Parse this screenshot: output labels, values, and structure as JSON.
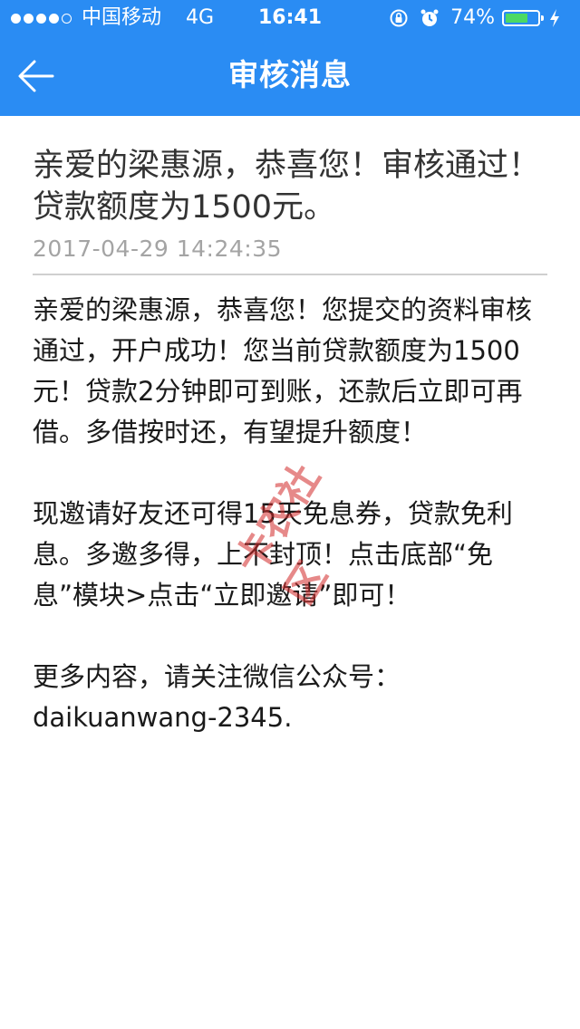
{
  "status_bar": {
    "carrier": "中国移动",
    "network": "4G",
    "time": "16:41",
    "battery_percent": "74%",
    "battery_level": 0.74,
    "battery_color": "#4cd964"
  },
  "nav": {
    "back_icon": "back-arrow-icon",
    "title": "审核消息",
    "bg_color": "#2a8cf3"
  },
  "message": {
    "title": "亲爱的梁惠源，恭喜您！审核通过！贷款额度为1500元。",
    "timestamp": "2017-04-29 14:24:35",
    "body": "亲爱的梁惠源，恭喜您！您提交的资料审核通过，开户成功！您当前贷款额度为1500元！贷款2分钟即可到账，还款后立即可再借。多借按时还，有望提升额度！\n\n现邀请好友还可得15天免息券，贷款免利息。多邀多得，上不封顶！点击底部“免息”模块>点击“立即邀请”即可！\n\n更多内容，请关注微信公众号：daikuanwang-2345."
  },
  "watermark": {
    "text": "卡农社区"
  }
}
